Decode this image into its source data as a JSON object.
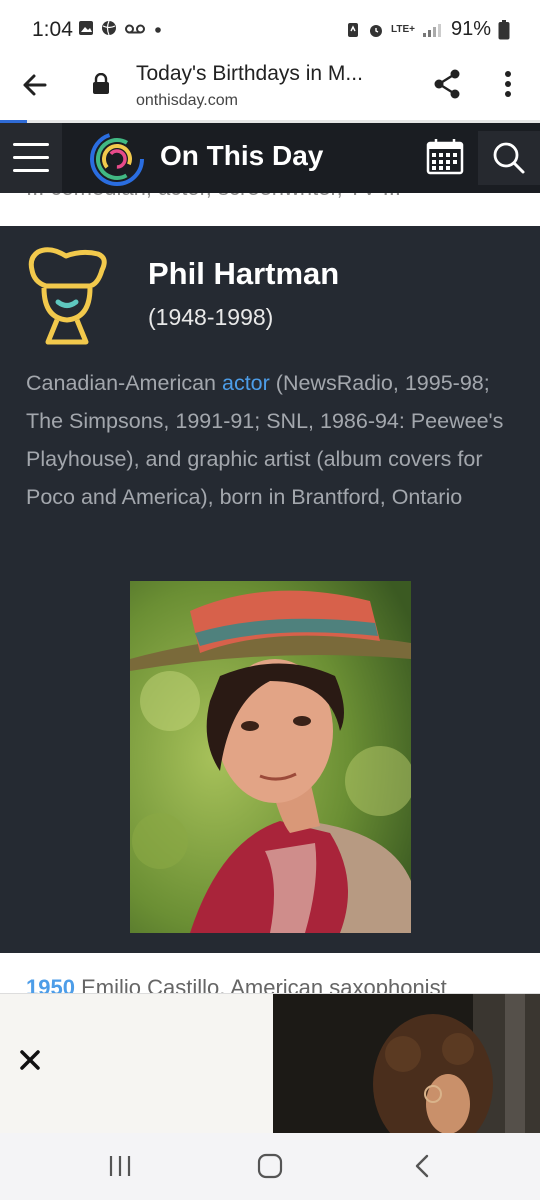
{
  "status_bar": {
    "time": "1:04",
    "network": "LTE+",
    "battery": "91%"
  },
  "browser": {
    "page_title": "Today's Birthdays in M...",
    "url": "onthisday.com",
    "load_progress": 0.05
  },
  "site": {
    "name": "On This Day",
    "accent_colors": [
      "#2a6de0",
      "#41b883",
      "#f2c94c",
      "#e84b8a"
    ]
  },
  "peek_text": "... comedian, actor, screenwriter, TV ...",
  "entry": {
    "name": "Phil Hartman",
    "years": "(1948-1998)",
    "desc_before": "Canadian-American ",
    "desc_link": "actor",
    "desc_after": " (NewsRadio, 1995-98; The Simpsons, 1991-91; SNL, 1986-94: Peewee's Playhouse), and graphic artist (album covers for Poco and America), born in Brantford, Ontario"
  },
  "next_entry": {
    "year": "1950",
    "text": "Emilio Castillo, American saxophonist"
  },
  "ad": {
    "close_label": "×"
  }
}
